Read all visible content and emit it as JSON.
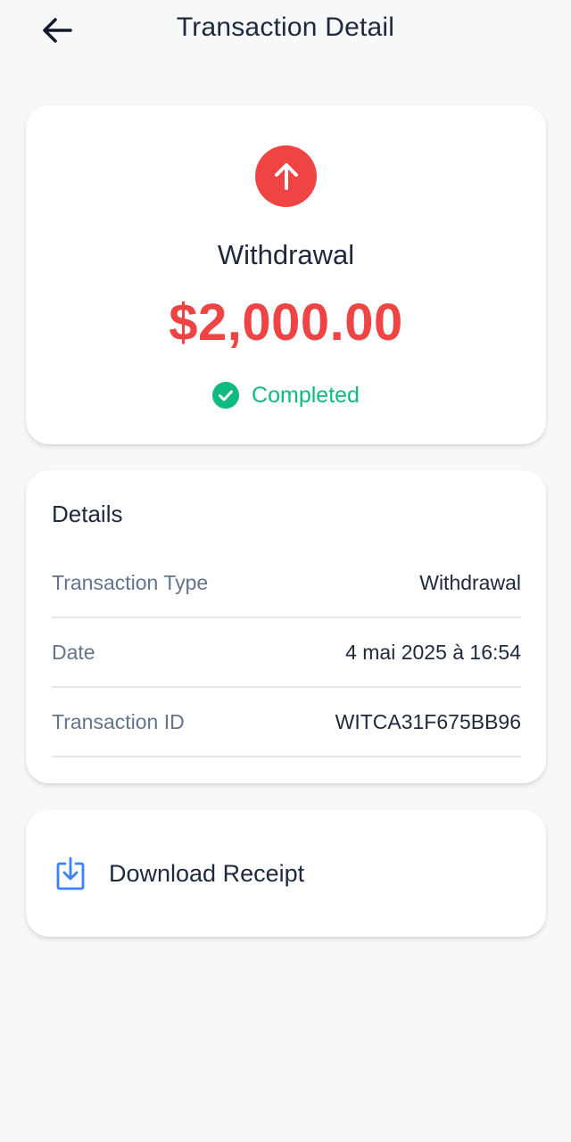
{
  "header": {
    "title": "Transaction Detail",
    "back_icon": "arrow-left-icon"
  },
  "summary": {
    "icon": "arrow-up-icon",
    "icon_bg_color": "#ef4444",
    "type": "Withdrawal",
    "amount": "$2,000.00",
    "amount_color": "#ef4444",
    "status": {
      "icon": "check-circle-icon",
      "label": "Completed",
      "color": "#10b981"
    }
  },
  "details": {
    "title": "Details",
    "rows": [
      {
        "label": "Transaction Type",
        "value": "Withdrawal"
      },
      {
        "label": "Date",
        "value": "4 mai 2025 à 16:54"
      },
      {
        "label": "Transaction ID",
        "value": "WITCA31F675BB96"
      }
    ]
  },
  "download": {
    "icon": "download-icon",
    "label": "Download Receipt",
    "icon_color": "#3b82f6"
  }
}
